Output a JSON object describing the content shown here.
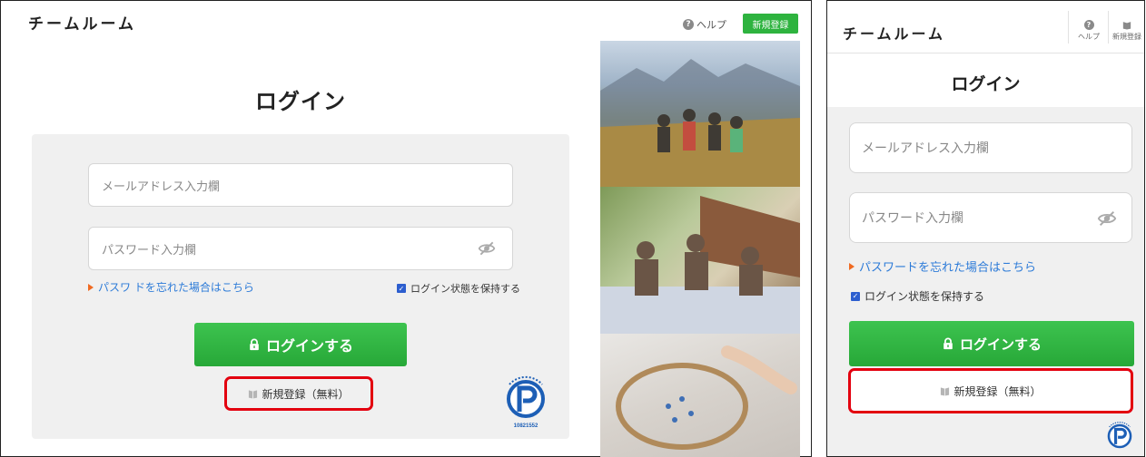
{
  "desktop": {
    "logo": "チームルーム",
    "help_label": "ヘルプ",
    "signup_label": "新規登録",
    "title": "ログイン",
    "email_placeholder": "メールアドレス入力欄",
    "password_placeholder": "パスワード入力欄",
    "forgot_link": "パスワ ドを忘れた場合はこちら",
    "keep_login": "ログイン状態を保持する",
    "keep_login_checked": true,
    "login_button": "ログインする",
    "register_button": "新規登録（無料）",
    "privacy_mark_number": "10821552"
  },
  "mobile": {
    "logo": "チームルーム",
    "help_label": "ヘルプ",
    "signup_label": "新規登録",
    "title": "ログイン",
    "email_placeholder": "メールアドレス入力欄",
    "password_placeholder": "パスワード入力欄",
    "forgot_link": "パスワードを忘れた場合はこちら",
    "keep_login": "ログイン状態を保持する",
    "keep_login_checked": true,
    "login_button": "ログインする",
    "register_button": "新規登録（無料）"
  },
  "colors": {
    "accent_green": "#2eb33f",
    "link_blue": "#2d7bd8",
    "highlight_red": "#e3000f",
    "arrow_orange": "#f06a21",
    "checkbox_blue": "#2c5ecf"
  },
  "icons": [
    "help-icon",
    "eye-slash-icon",
    "lock-icon",
    "book-icon",
    "privacy-mark-icon",
    "triangle-arrow-icon",
    "checkbox-icon",
    "signup-book-icon"
  ]
}
